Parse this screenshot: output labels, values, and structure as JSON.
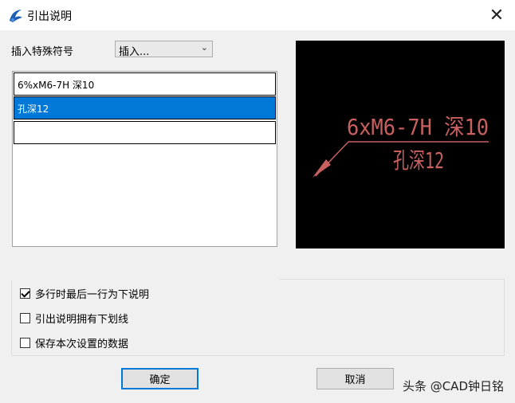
{
  "window": {
    "title": "引出说明",
    "close_glyph": "✕",
    "icon": "cad-app-icon"
  },
  "insert": {
    "label": "插入特殊符号",
    "selected": "插入...",
    "chevron": "⌄"
  },
  "lines": [
    {
      "text": "6%xM6-7H 深10",
      "selected": false
    },
    {
      "text": "孔深12",
      "selected": true
    },
    {
      "text": "",
      "selected": false
    }
  ],
  "preview": {
    "line1": "6xM6-7H 深10",
    "line2": "孔深12",
    "color": "#c86060"
  },
  "options": [
    {
      "label": "多行时最后一行为下说明",
      "checked": true
    },
    {
      "label": "引出说明拥有下划线",
      "checked": false
    },
    {
      "label": "保存本次设置的数据",
      "checked": false
    }
  ],
  "buttons": {
    "ok": "确定",
    "cancel": "取消"
  },
  "watermark": "头条 @CAD钟日铭"
}
